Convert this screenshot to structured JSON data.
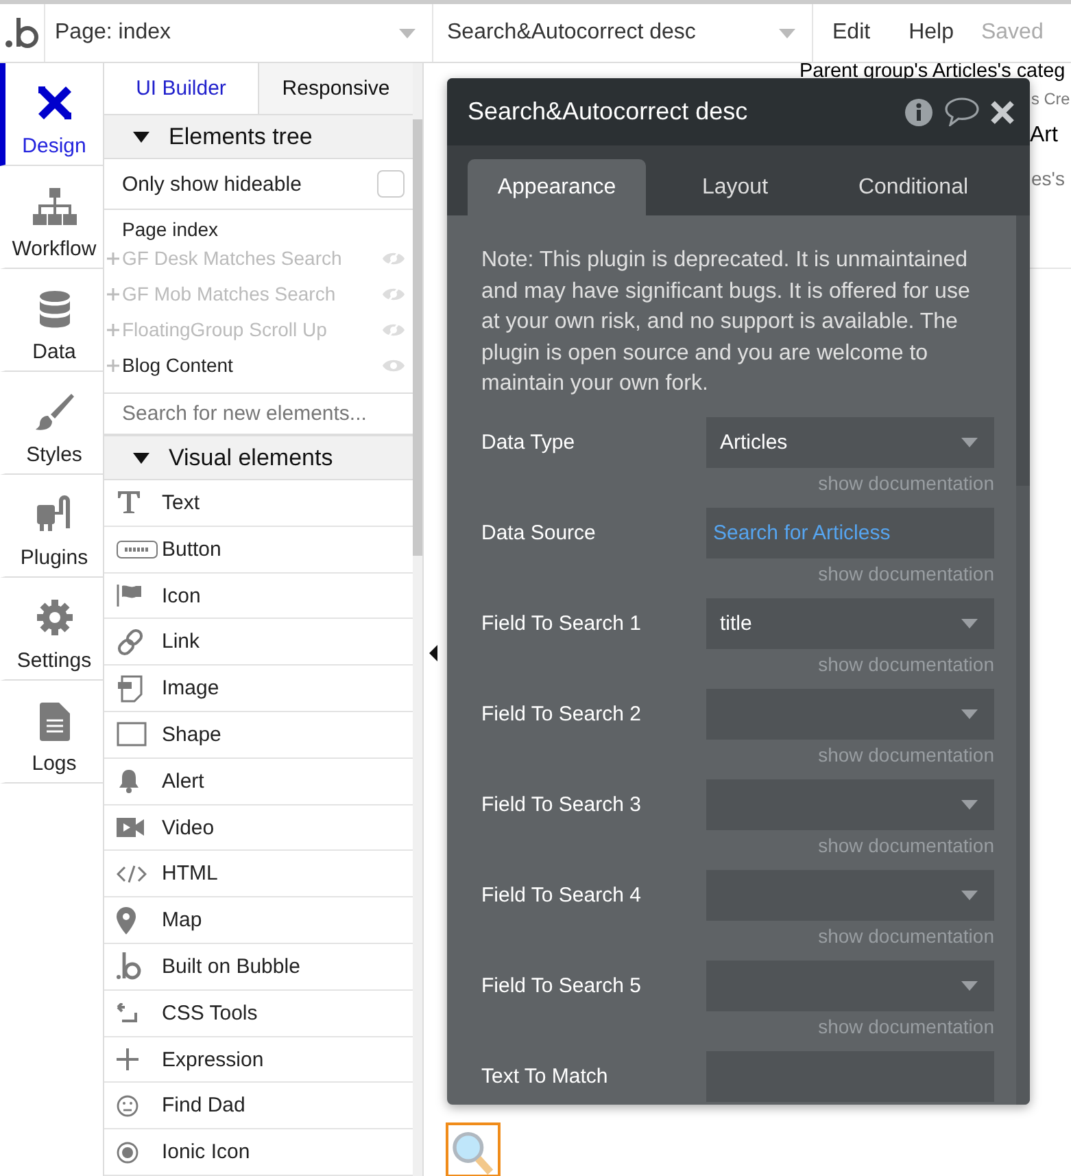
{
  "topbar": {
    "page_select": "Page: index",
    "element_select": "Search&Autocorrect desc",
    "menu": [
      "Edit",
      "Help"
    ],
    "status": "Saved"
  },
  "nav": [
    {
      "label": "Design",
      "kind": "design",
      "selected": true
    },
    {
      "label": "Workflow",
      "kind": "workflow",
      "selected": false
    },
    {
      "label": "Data",
      "kind": "data",
      "selected": false
    },
    {
      "label": "Styles",
      "kind": "styles",
      "selected": false
    },
    {
      "label": "Plugins",
      "kind": "plugins",
      "selected": false
    },
    {
      "label": "Settings",
      "kind": "settings",
      "selected": false
    },
    {
      "label": "Logs",
      "kind": "logs",
      "selected": false
    }
  ],
  "panel": {
    "tabs": [
      {
        "label": "UI Builder",
        "selected": true
      },
      {
        "label": "Responsive",
        "selected": false
      }
    ],
    "tree": {
      "title": "Elements tree",
      "expanded": true,
      "filter": {
        "label": "Only show hideable",
        "checked": false
      },
      "root": "Page index",
      "items": [
        {
          "label": "GF Desk Matches Search",
          "visible": false
        },
        {
          "label": "GF Mob Matches Search",
          "visible": false
        },
        {
          "label": "FloatingGroup Scroll Up",
          "visible": false
        },
        {
          "label": "Blog Content",
          "visible": true
        }
      ]
    },
    "search": {
      "placeholder": "Search for new elements..."
    },
    "visual": {
      "title": "Visual elements",
      "expanded": true,
      "items": [
        {
          "label": "Text",
          "kind": "text"
        },
        {
          "label": "Button",
          "kind": "button"
        },
        {
          "label": "Icon",
          "kind": "icon"
        },
        {
          "label": "Link",
          "kind": "link"
        },
        {
          "label": "Image",
          "kind": "image"
        },
        {
          "label": "Shape",
          "kind": "shape"
        },
        {
          "label": "Alert",
          "kind": "alert"
        },
        {
          "label": "Video",
          "kind": "video"
        },
        {
          "label": "HTML",
          "kind": "html"
        },
        {
          "label": "Map",
          "kind": "map"
        },
        {
          "label": "Built on Bubble",
          "kind": "bubble"
        },
        {
          "label": "CSS Tools",
          "kind": "css"
        },
        {
          "label": "Expression",
          "kind": "expression"
        },
        {
          "label": "Find Dad",
          "kind": "face"
        },
        {
          "label": "Ionic Icon",
          "kind": "ionic"
        }
      ]
    }
  },
  "canvas": {
    "texts": [
      {
        "text": "Parent group's Articles's categ",
        "kind": "link"
      },
      {
        "text": "s Cre",
        "kind": "meta"
      },
      {
        "text": "Art",
        "kind": "heading"
      },
      {
        "text": "es's",
        "kind": "meta"
      }
    ]
  },
  "dialog": {
    "title": "Search&Autocorrect desc",
    "tabs": [
      {
        "label": "Appearance",
        "selected": true
      },
      {
        "label": "Layout",
        "selected": false
      },
      {
        "label": "Conditional",
        "selected": false
      }
    ],
    "note": "Note: This plugin is deprecated. It is unmaintained and may have significant bugs. It is offered for use at your own risk, and no support is available. The plugin is open source and you are welcome to maintain your own fork.",
    "fields": [
      {
        "label": "Data Type",
        "kind": "dropdown",
        "value": "Articles",
        "doc": "show documentation"
      },
      {
        "label": "Data Source",
        "kind": "expression",
        "value": "Search for Articless",
        "doc": "show documentation"
      },
      {
        "label": "Field To Search 1",
        "kind": "dropdown",
        "value": "title",
        "doc": "show documentation"
      },
      {
        "label": "Field To Search 2",
        "kind": "dropdown",
        "doc": "show documentation"
      },
      {
        "label": "Field To Search 3",
        "kind": "dropdown",
        "doc": "show documentation"
      },
      {
        "label": "Field To Search 4",
        "kind": "dropdown",
        "doc": "show documentation"
      },
      {
        "label": "Field To Search 5",
        "kind": "dropdown",
        "doc": "show documentation"
      },
      {
        "label": "Text To Match",
        "kind": "input"
      }
    ]
  }
}
